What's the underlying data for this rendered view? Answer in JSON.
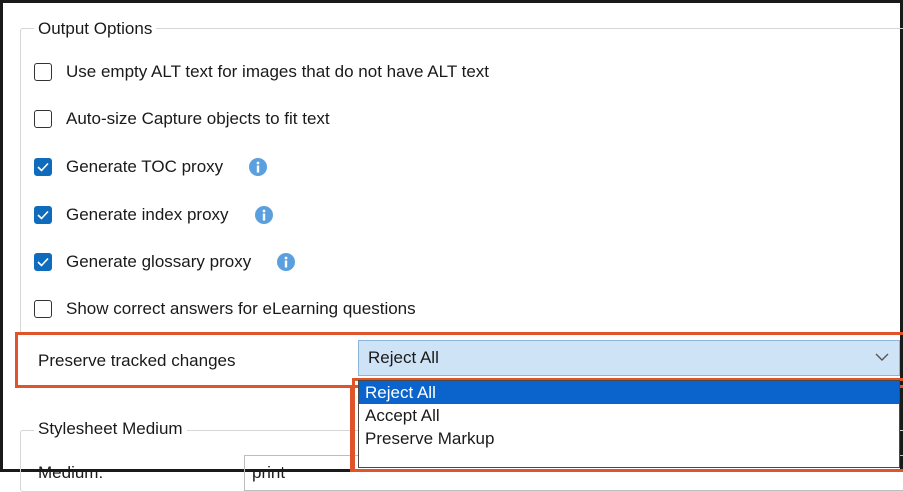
{
  "output_options": {
    "title": "Output Options",
    "items": [
      {
        "label": "Use empty ALT text for images that do not have ALT text",
        "checked": false,
        "info": false
      },
      {
        "label": "Auto-size Capture objects to fit text",
        "checked": false,
        "info": false
      },
      {
        "label": "Generate TOC proxy",
        "checked": true,
        "info": true
      },
      {
        "label": "Generate index proxy",
        "checked": true,
        "info": true
      },
      {
        "label": "Generate glossary proxy",
        "checked": true,
        "info": true
      },
      {
        "label": "Show correct answers for eLearning questions",
        "checked": false,
        "info": false
      }
    ]
  },
  "tracked_changes": {
    "label": "Preserve tracked changes",
    "selected": "Reject All",
    "options": [
      "Reject All",
      "Accept All",
      "Preserve Markup"
    ]
  },
  "stylesheet": {
    "title": "Stylesheet Medium",
    "medium_label": "Medium:",
    "medium_value": "print"
  },
  "colors": {
    "highlight": "#e0542a",
    "checkbox_checked": "#0f6cbd",
    "info_icon": "#5aa0df",
    "selected_option": "#0a64cc",
    "select_bg": "#cfe3f7"
  },
  "icons": {
    "checkbox_checked": "checkmark-icon",
    "info": "info-icon",
    "dropdown": "chevron-down-icon"
  }
}
